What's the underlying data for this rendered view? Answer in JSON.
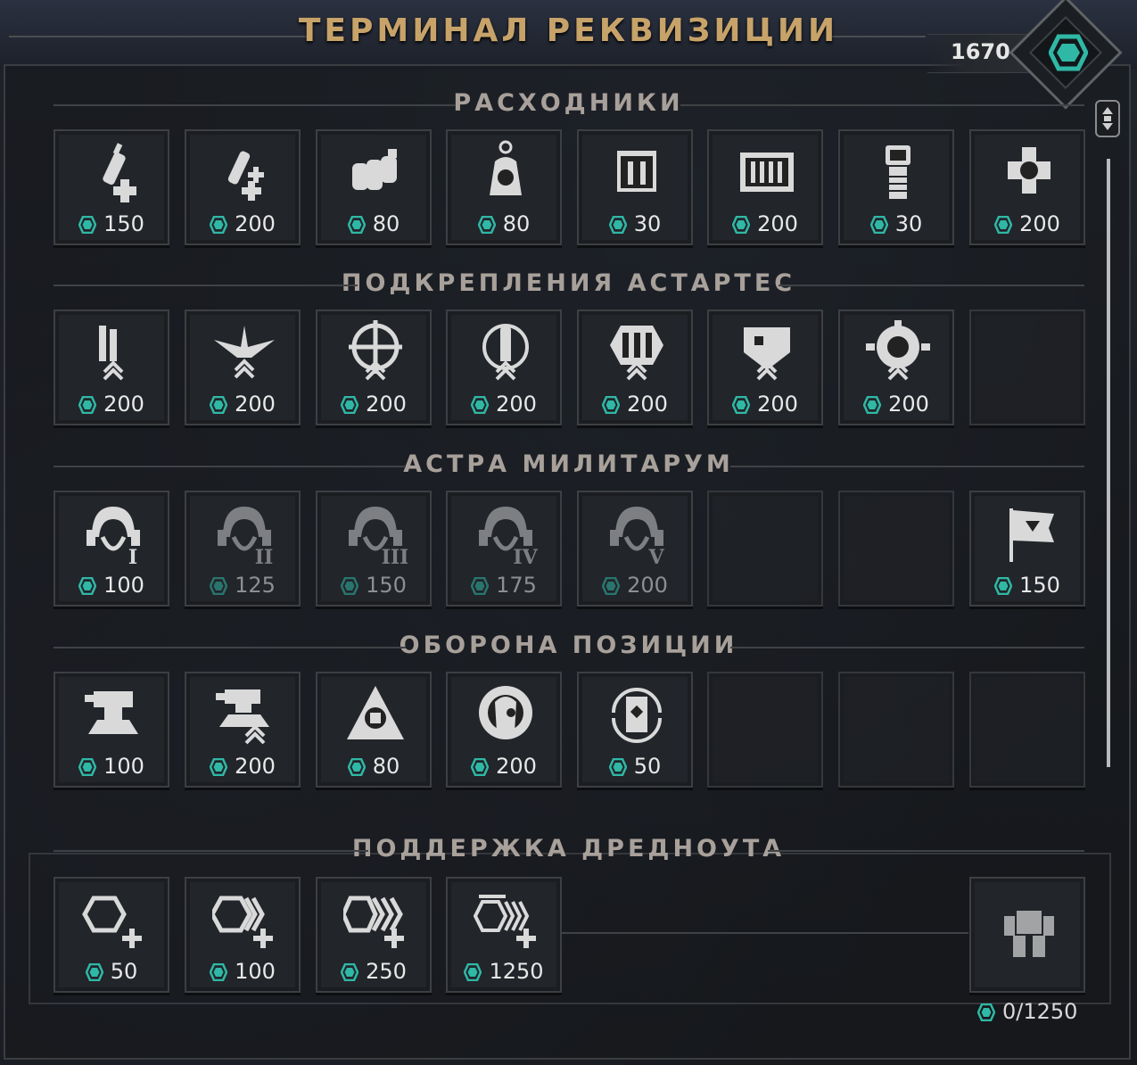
{
  "title": "ТЕРМИНАЛ РЕКВИЗИЦИИ",
  "currency": {
    "amount": "1670",
    "icon": "requisition-gem-icon"
  },
  "colors": {
    "gem": "#2fb8a6",
    "title": "#c7a36a",
    "section": "#a8a09a"
  },
  "sections": [
    {
      "title": "РАСХОДНИКИ",
      "items": [
        {
          "icon": "stimm-syringe-icon",
          "price": "150"
        },
        {
          "icon": "stimm-syringe-double-icon",
          "price": "200"
        },
        {
          "icon": "grenade-pack-icon",
          "price": "80"
        },
        {
          "icon": "skull-beacon-icon",
          "price": "80"
        },
        {
          "icon": "ammo-box-icon",
          "price": "30"
        },
        {
          "icon": "ammo-crate-icon",
          "price": "200"
        },
        {
          "icon": "auspex-device-icon",
          "price": "30"
        },
        {
          "icon": "skull-cross-icon",
          "price": "200"
        }
      ]
    },
    {
      "title": "ПОДКРЕПЛЕНИЯ АСТАРТЕС",
      "items": [
        {
          "icon": "chainsword-upgrade-icon",
          "price": "200"
        },
        {
          "icon": "aquila-upgrade-icon",
          "price": "200"
        },
        {
          "icon": "crosshair-upgrade-icon",
          "price": "200"
        },
        {
          "icon": "bolt-shell-upgrade-icon",
          "price": "200"
        },
        {
          "icon": "ammo-upgrade-icon",
          "price": "200"
        },
        {
          "icon": "armor-upgrade-icon",
          "price": "200"
        },
        {
          "icon": "gear-upgrade-icon",
          "price": "200"
        },
        {
          "empty": true
        }
      ]
    },
    {
      "title": "АСТРА МИЛИТАРУМ",
      "items": [
        {
          "icon": "guard-helmet-1-icon",
          "price": "100"
        },
        {
          "icon": "guard-helmet-2-icon",
          "price": "125",
          "locked": true
        },
        {
          "icon": "guard-helmet-3-icon",
          "price": "150",
          "locked": true
        },
        {
          "icon": "guard-helmet-4-icon",
          "price": "175",
          "locked": true
        },
        {
          "icon": "guard-helmet-5-icon",
          "price": "200",
          "locked": true
        },
        {
          "empty": true
        },
        {
          "empty": true
        },
        {
          "icon": "aquila-banner-icon",
          "price": "150"
        }
      ]
    },
    {
      "title": "ОБОРОНА ПОЗИЦИИ",
      "items": [
        {
          "icon": "sentry-turret-icon",
          "price": "100"
        },
        {
          "icon": "sentry-turret-upgrade-icon",
          "price": "200"
        },
        {
          "icon": "mine-device-icon",
          "price": "80"
        },
        {
          "icon": "servitor-skull-icon",
          "price": "200"
        },
        {
          "icon": "supply-barrel-icon",
          "price": "50"
        },
        {
          "empty": true
        },
        {
          "empty": true
        },
        {
          "empty": true
        }
      ]
    },
    {
      "title": "ПОДДЕРЖКА ДРЕДНОУТА",
      "items": [
        {
          "icon": "gem-plus-1-icon",
          "price": "50"
        },
        {
          "icon": "gem-plus-2-icon",
          "price": "100"
        },
        {
          "icon": "gem-plus-3-icon",
          "price": "250"
        },
        {
          "icon": "gem-plus-4-icon",
          "price": "1250"
        }
      ],
      "dreadnought": {
        "icon": "dreadnought-icon",
        "progress": "0/1250"
      }
    }
  ]
}
